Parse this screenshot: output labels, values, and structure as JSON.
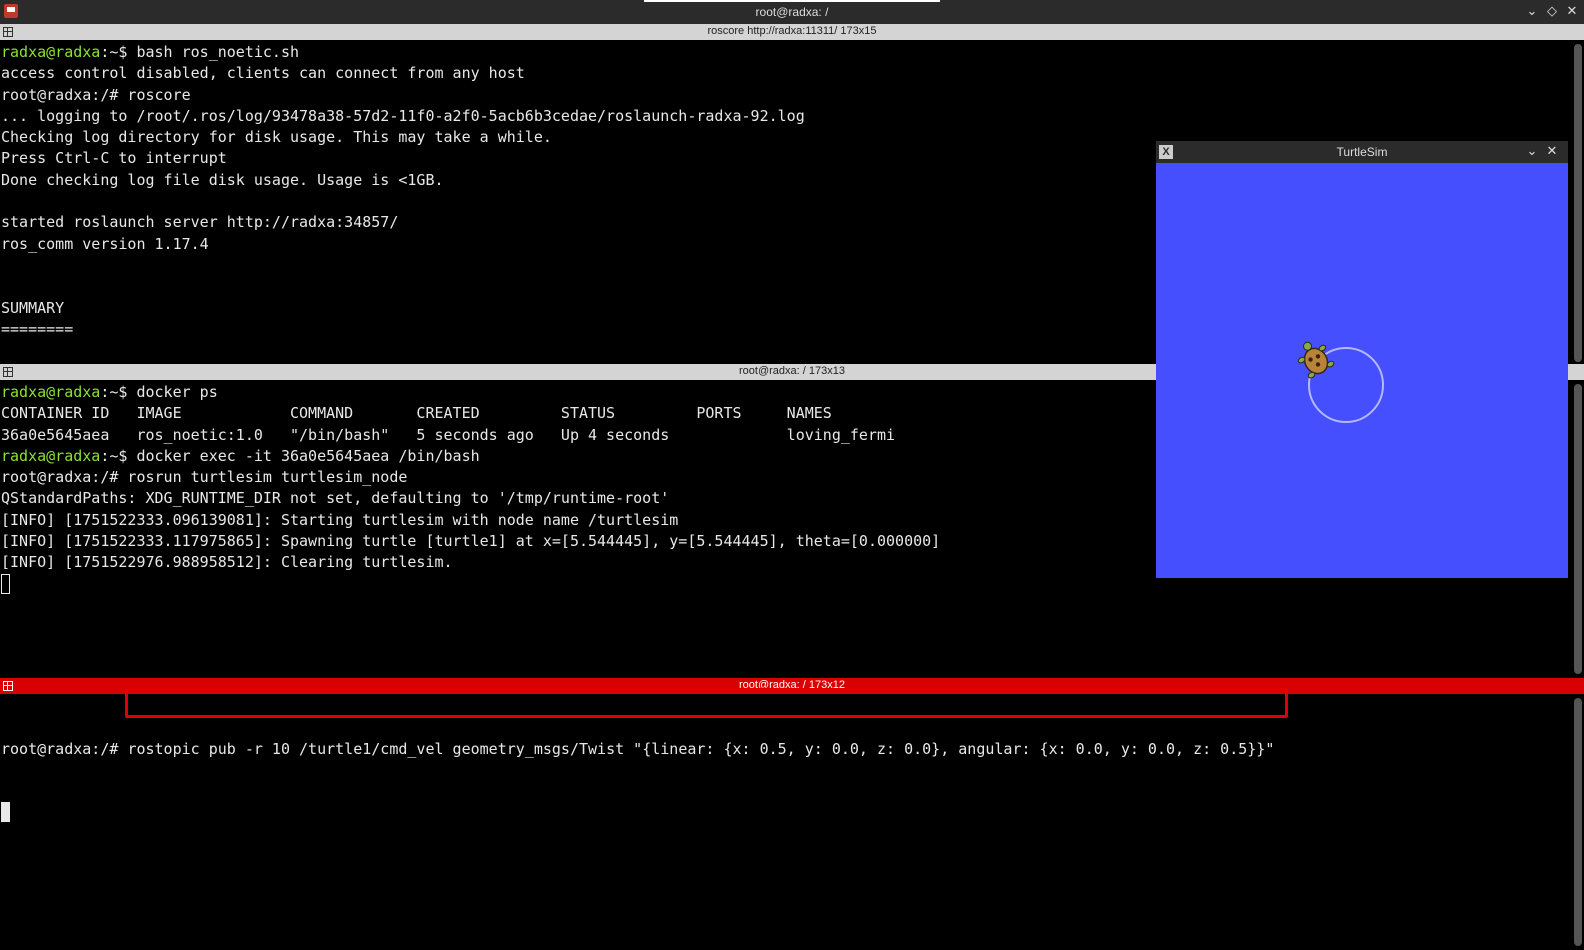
{
  "window": {
    "title": "root@radxa: /",
    "controls": {
      "minimize": "⌄",
      "maximize": "◇",
      "close": "✕"
    }
  },
  "panes": [
    {
      "header": "roscore http://radxa:11311/ 173x15",
      "lines": [
        {
          "user": "radxa@radxa",
          "path": ":~$",
          "cmd": " bash ros_noetic.sh"
        },
        {
          "text": "access control disabled, clients can connect from any host"
        },
        {
          "text": "root@radxa:/# roscore"
        },
        {
          "text": "... logging to /root/.ros/log/93478a38-57d2-11f0-a2f0-5acb6b3cedae/roslaunch-radxa-92.log"
        },
        {
          "text": "Checking log directory for disk usage. This may take a while."
        },
        {
          "text": "Press Ctrl-C to interrupt"
        },
        {
          "text": "Done checking log file disk usage. Usage is <1GB."
        },
        {
          "text": ""
        },
        {
          "text": "started roslaunch server http://radxa:34857/"
        },
        {
          "text": "ros_comm version 1.17.4"
        },
        {
          "text": ""
        },
        {
          "text": ""
        },
        {
          "text": "SUMMARY"
        },
        {
          "text": "========"
        }
      ]
    },
    {
      "header": "root@radxa: / 173x13",
      "lines": [
        {
          "user": "radxa@radxa",
          "path": ":~$",
          "cmd": " docker ps"
        },
        {
          "text": "CONTAINER ID   IMAGE            COMMAND       CREATED         STATUS         PORTS     NAMES"
        },
        {
          "text": "36a0e5645aea   ros_noetic:1.0   \"/bin/bash\"   5 seconds ago   Up 4 seconds             loving_fermi"
        },
        {
          "user": "radxa@radxa",
          "path": ":~$",
          "cmd": " docker exec -it 36a0e5645aea /bin/bash"
        },
        {
          "text": "root@radxa:/# rosrun turtlesim turtlesim_node"
        },
        {
          "text": "QStandardPaths: XDG_RUNTIME_DIR not set, defaulting to '/tmp/runtime-root'"
        },
        {
          "text": "[INFO] [1751522333.096139081]: Starting turtlesim with node name /turtlesim"
        },
        {
          "text": "[INFO] [1751522333.117975865]: Spawning turtle [turtle1] at x=[5.544445], y=[5.544445], theta=[0.000000]"
        },
        {
          "text": "[INFO] [1751522976.988958512]: Clearing turtlesim."
        }
      ]
    },
    {
      "header": "root@radxa: / 173x12",
      "prompt": "root@radxa:/# ",
      "command": "rostopic pub -r 10 /turtle1/cmd_vel geometry_msgs/Twist \"{linear: {x: 0.5, y: 0.0, z: 0.0}, angular: {x: 0.0, y: 0.0, z: 0.5}}\""
    }
  ],
  "turtlesim": {
    "title": "TurtleSim",
    "x_icon_label": "X",
    "controls": {
      "minimize": "⌄",
      "close": "✕"
    },
    "background_color": "#454ffe",
    "trail_color": "#b3b8ff"
  },
  "highlight_color": "#e00000"
}
